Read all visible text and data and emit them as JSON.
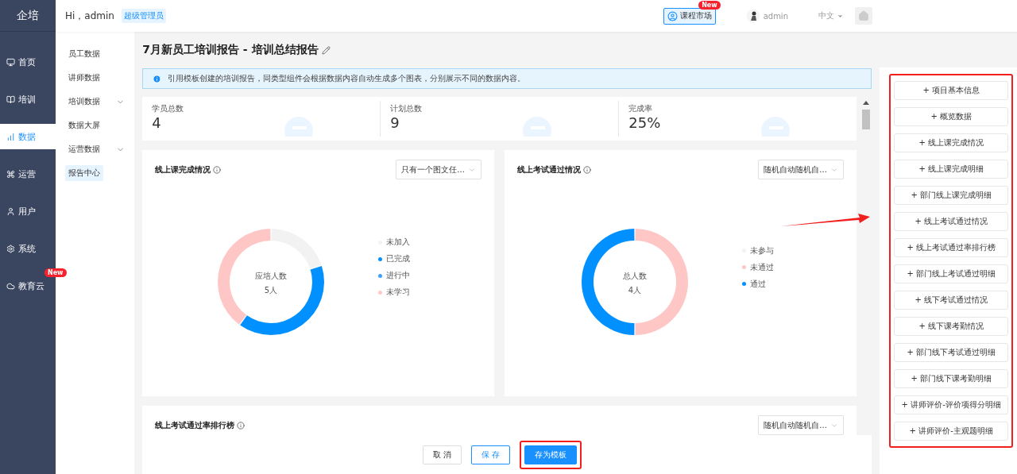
{
  "logo": "企培",
  "nav": [
    {
      "label": "首页",
      "selected": false
    },
    {
      "label": "培训",
      "selected": false
    },
    {
      "label": "数据",
      "selected": true
    },
    {
      "label": "运营",
      "selected": false
    },
    {
      "label": "用户",
      "selected": false
    },
    {
      "label": "系统",
      "selected": false
    },
    {
      "label": "教育云",
      "selected": false,
      "badge": "New"
    }
  ],
  "header": {
    "greeting": "Hi，admin",
    "role": "超级管理员",
    "market": {
      "label": "课程市场",
      "badge": "New"
    },
    "user": "admin",
    "language": "中文"
  },
  "subnav": [
    {
      "label": "员工数据",
      "expandable": false,
      "selected": false
    },
    {
      "label": "讲师数据",
      "expandable": false,
      "selected": false
    },
    {
      "label": "培训数据",
      "expandable": true,
      "selected": false
    },
    {
      "label": "数据大屏",
      "expandable": false,
      "selected": false
    },
    {
      "label": "运营数据",
      "expandable": true,
      "selected": false
    },
    {
      "label": "报告中心",
      "expandable": false,
      "selected": true
    }
  ],
  "report": {
    "title": "7月新员工培训报告 - 培训总结报告",
    "notice": "引用模板创建的培训报告，同类型组件会根据数据内容自动生成多个图表，分别展示不同的数据内容。"
  },
  "stats": [
    {
      "label": "学员总数",
      "value": "4"
    },
    {
      "label": "计划总数",
      "value": "9"
    },
    {
      "label": "完成率",
      "value": "25%"
    }
  ],
  "charts": [
    {
      "title": "线上课完成情况",
      "select": "只有一个图文任...",
      "center_label": "应培人数",
      "center_value": "5人",
      "chart_data": {
        "type": "donut",
        "categories": [
          "未加入",
          "已完成",
          "进行中",
          "未学习"
        ],
        "values": [
          20,
          40,
          0,
          40
        ],
        "colors": [
          "#f2f2f2",
          "#0090ff",
          "#3aa1ff",
          "#ffc6c6"
        ]
      }
    },
    {
      "title": "线上考试通过情况",
      "select": "随机自动随机自...",
      "center_label": "总人数",
      "center_value": "4人",
      "chart_data": {
        "type": "donut",
        "categories": [
          "未参与",
          "未通过",
          "通过"
        ],
        "values": [
          0,
          50,
          50
        ],
        "colors": [
          "#f2f2f2",
          "#ffc6c6",
          "#0090ff"
        ]
      }
    }
  ],
  "ranking": {
    "title": "线上考试通过率排行榜",
    "select": "随机自动随机自..."
  },
  "footer": [
    {
      "label": "取 消",
      "kind": "default"
    },
    {
      "label": "保 存",
      "kind": "outline"
    },
    {
      "label": "存为模板",
      "kind": "primary"
    }
  ],
  "components": [
    "+ 项目基本信息",
    "+ 概览数据",
    "+ 线上课完成情况",
    "+ 线上课完成明细",
    "+ 部门线上课完成明细",
    "+ 线上考试通过情况",
    "+ 线上考试通过率排行榜",
    "+ 部门线上考试通过明细",
    "+ 线下考试通过情况",
    "+ 线下课考勤情况",
    "+ 部门线下考试通过明细",
    "+ 部门线下课考勤明细",
    "+ 讲师评价-评价项得分明细",
    "+ 讲师评价-主观题明细"
  ]
}
